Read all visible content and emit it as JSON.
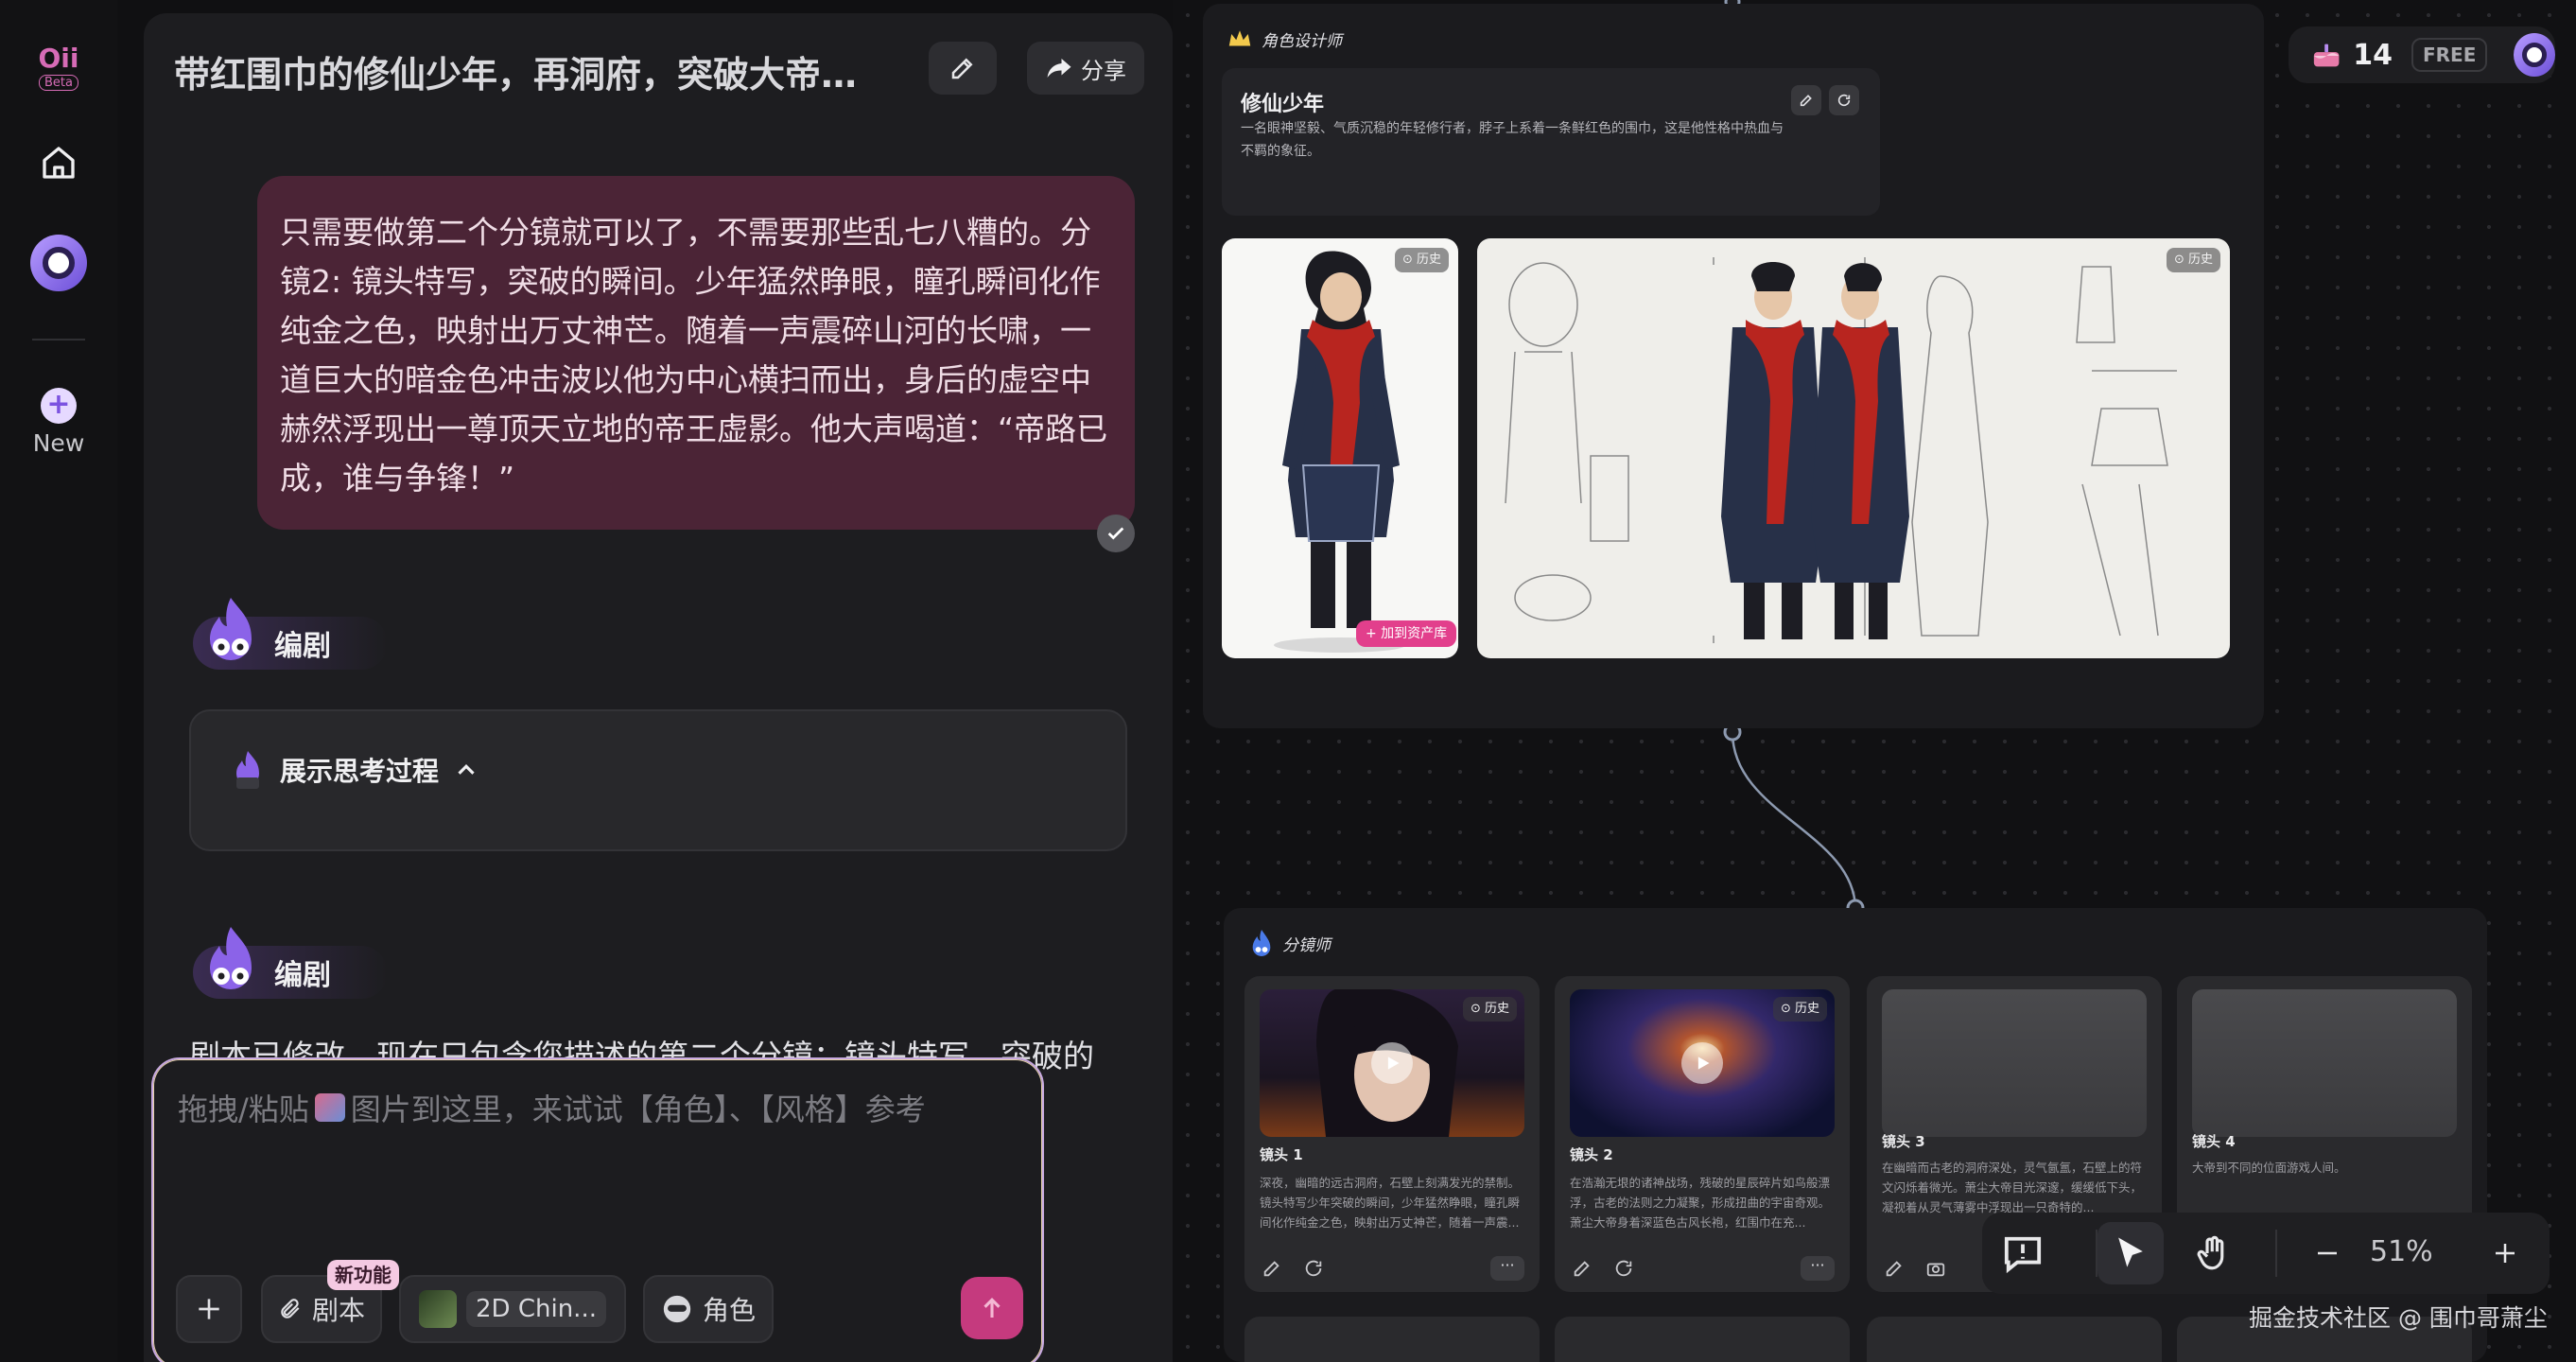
{
  "nav": {
    "logo_text": "Oii",
    "logo_badge": "Beta",
    "new_label": "New"
  },
  "chat": {
    "title": "带红围巾的修仙少年，再洞府，突破大帝…",
    "share_label": "分享",
    "user_message": "只需要做第二个分镜就可以了，不需要那些乱七八糟的。分镜2: 镜头特写，突破的瞬间。少年猛然睁眼，瞳孔瞬间化作纯金之色，映射出万丈神芒。随着一声震碎山河的长啸，一道巨大的暗金色冲击波以他为中心横扫而出，身后的虚空中赫然浮现出一尊顶天立地的帝王虚影。他大声喝道：“帝路已成，谁与争锋！”",
    "role_name": "编剧",
    "think_label": "展示思考过程",
    "reply_text": "剧本已修改，现在只包含您描述的第二个分镜：镜头特写，突破的"
  },
  "input": {
    "placeholder_prefix": "拖拽/粘贴",
    "placeholder_suffix": "图片到这里，来试试【角色】、【风格】参考",
    "new_feature_badge": "新功能",
    "script_button": "剧本",
    "style_button": "2D Chin...",
    "role_button": "角色"
  },
  "canvas": {
    "char_node_label": "角色设计师",
    "char_name": "修仙少年",
    "char_desc": "一名眼神坚毅、气质沉稳的年轻修行者，脖子上系着一条鲜红色的围巾，这是他性格中热血与不羁的象征。",
    "history_label": "历史",
    "add_library_label": "+ 加到资产库",
    "storyboard_node_label": "分镜师",
    "shots": [
      {
        "name": "镜头 1",
        "desc": "深夜，幽暗的远古洞府，石壁上刻满发光的禁制。镜头特写少年突破的瞬间，少年猛然睁眼，瞳孔瞬间化作纯金之色，映射出万丈神芒，随着一声震..."
      },
      {
        "name": "镜头 2",
        "desc": "在浩瀚无垠的诸神战场，残破的星辰碎片如鸟般漂浮，古老的法则之力凝聚，形成扭曲的宇宙奇观。萧尘大帝身着深蓝色古风长袍，红围巾在充..."
      },
      {
        "name": "镜头 3",
        "desc": "在幽暗而古老的洞府深处，灵气氤氲，石壁上的符文闪烁着微光。萧尘大帝目光深邃，缓缓低下头，凝视着从灵气薄雾中浮现出一只奇特的..."
      },
      {
        "name": "镜头 4",
        "desc": "大帝到不同的位面游戏人间。"
      }
    ]
  },
  "topbar": {
    "credits": "14",
    "plan": "FREE"
  },
  "toolbar": {
    "zoom": "51%"
  },
  "watermark": "掘金技术社区 @ 围巾哥萧尘",
  "colors": {
    "accent_pink": "#c53a7e",
    "user_bubble": "#4b2436",
    "nav_logo": "#d66bb6"
  }
}
